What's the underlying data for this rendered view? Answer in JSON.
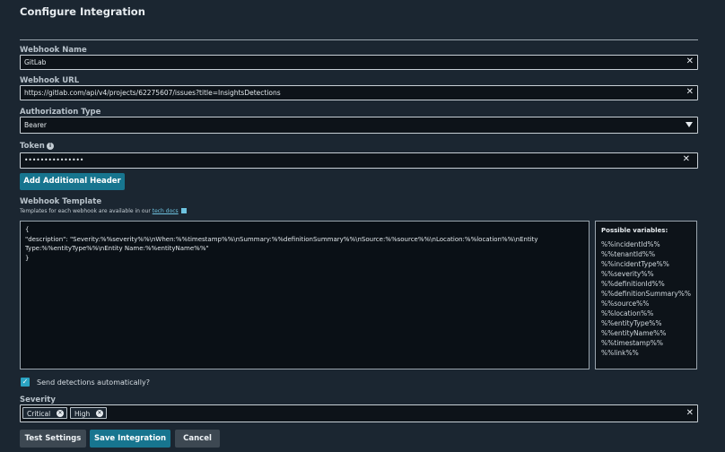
{
  "page": {
    "title": "Configure Integration"
  },
  "webhook_name": {
    "label": "Webhook Name",
    "value": "GitLab",
    "clear": "✕"
  },
  "webhook_url": {
    "label": "Webhook URL",
    "value": "https://gitlab.com/api/v4/projects/62275607/issues?title=InsightsDetections",
    "clear": "✕"
  },
  "auth_type": {
    "label": "Authorization Type",
    "value": "Bearer"
  },
  "token": {
    "label": "Token",
    "value": "•••••••••••••••",
    "clear": "✕",
    "info": "i"
  },
  "add_header_button": "Add Additional Header",
  "template": {
    "label": "Webhook Template",
    "hint_prefix": "Templates for each webhook are available in our",
    "hint_link": "tech docs",
    "body": "{\n\"description\": \"Severity:%%severity%%\\nWhen:%%timestamp%%\\nSummary:%%definitionSummary%%\\nSource:%%source%%\\nLocation:%%location%%\\nEntity Type:%%entityType%%\\nEntity Name:%%entityName%%\"\n}"
  },
  "variables": {
    "title": "Possible variables:",
    "items": [
      "%%incidentId%%",
      "%%tenantId%%",
      "%%incidentType%%",
      "%%severity%%",
      "%%definitionId%%",
      "%%definitionSummary%%",
      "%%source%%",
      "%%location%%",
      "%%entityType%%",
      "%%entityName%%",
      "%%timestamp%%",
      "%%link%%"
    ]
  },
  "auto_send": {
    "label": "Send detections automatically?",
    "checked": true,
    "mark": "✓"
  },
  "severity": {
    "label": "Severity",
    "chips": [
      "Critical",
      "High"
    ],
    "chip_remove": "✕",
    "clear": "✕"
  },
  "footer": {
    "test": "Test Settings",
    "save": "Save Integration",
    "cancel": "Cancel"
  }
}
